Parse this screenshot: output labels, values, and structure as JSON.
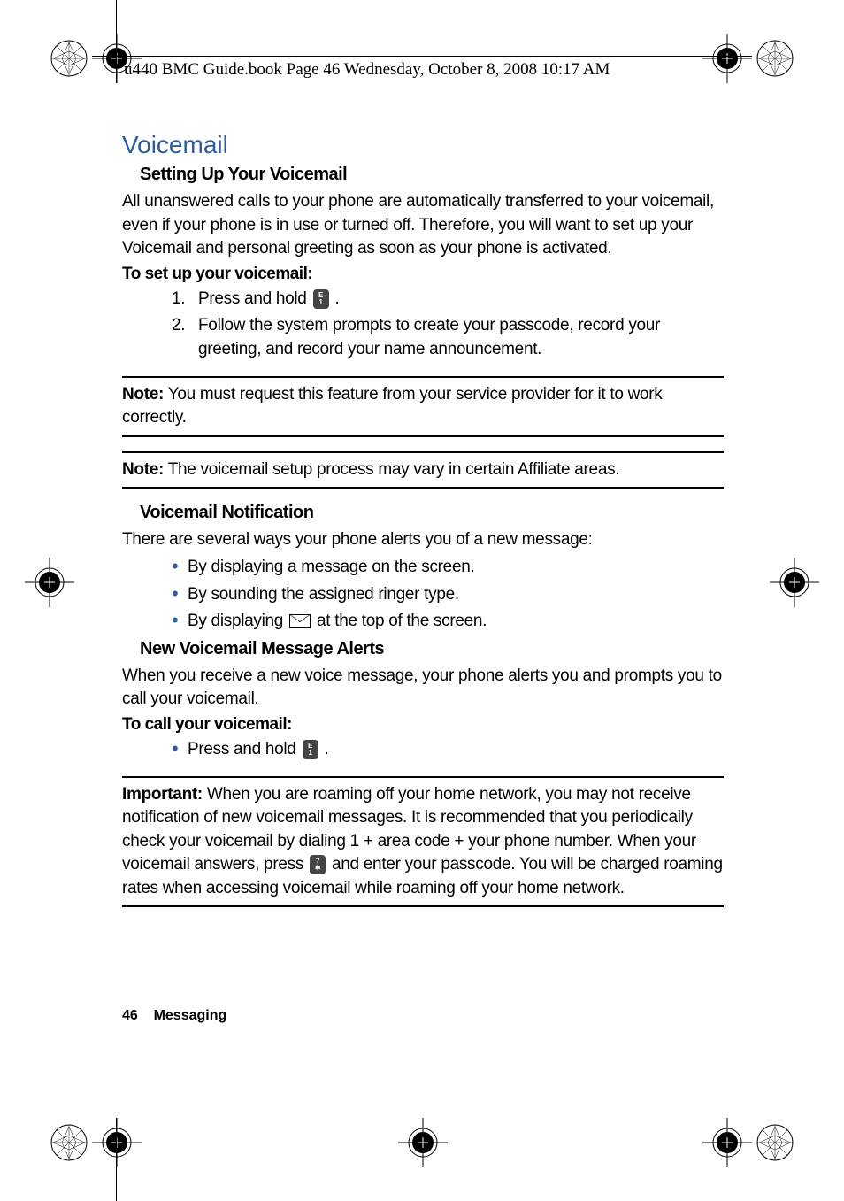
{
  "header": "u440 BMC Guide.book  Page 46  Wednesday, October 8, 2008  10:17 AM",
  "section_title": "Voicemail",
  "sub1": {
    "title": "Setting Up Your Voicemail",
    "para": "All unanswered calls to your phone are automatically transferred to your voicemail, even if your phone is in use or turned off. Therefore, you will want to set up your Voicemail and personal greeting as soon as your phone is activated.",
    "procedure_title": "To set up your voicemail:",
    "step1_num": "1.",
    "step1_a": "Press and hold ",
    "step1_b": " .",
    "step2_num": "2.",
    "step2": "Follow the system prompts to create your passcode, record your greeting, and record your name announcement."
  },
  "note1": {
    "label": "Note:",
    "text": " You must request this feature from your service provider for it to work correctly."
  },
  "note2": {
    "label": "Note:",
    "text": " The voicemail setup process may vary in certain Affiliate areas."
  },
  "sub2": {
    "title": "Voicemail Notification",
    "para": "There are several ways your phone alerts you of a new message:",
    "b1": "By displaying a message on the screen.",
    "b2": "By sounding the assigned ringer type.",
    "b3_a": "By displaying ",
    "b3_b": " at the top of the screen."
  },
  "sub3": {
    "title": "New Voicemail Message Alerts",
    "para": "When you receive a new voice message, your phone alerts you and prompts you to call your voicemail.",
    "procedure_title": "To call your voicemail:",
    "b1_a": "Press and hold ",
    "b1_b": " ."
  },
  "important": {
    "label": "Important:",
    "text_a": " When you are roaming off your home network, you may not receive notification of new voicemail messages. It is recommended that you periodically check your voicemail by dialing 1 + area code + your phone number. When your voicemail answers, press ",
    "text_b": " and enter your passcode. You will be charged roaming rates when accessing voicemail while roaming off your home network."
  },
  "footer": {
    "page": "46",
    "section": "Messaging"
  }
}
